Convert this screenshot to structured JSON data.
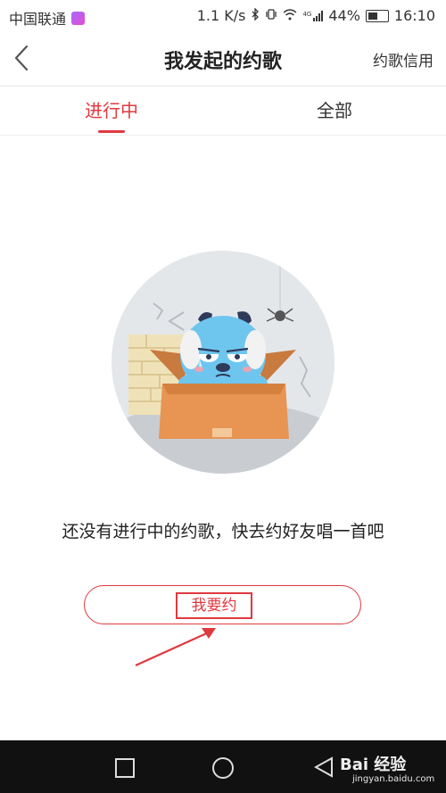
{
  "status_bar": {
    "carrier": "中国联通",
    "network_speed": "1.1 K/s",
    "network_type": "4G",
    "battery": "44%",
    "time": "16:10"
  },
  "nav": {
    "title": "我发起的约歌",
    "right_action": "约歌信用",
    "back_icon": "chevron-left-icon"
  },
  "tabs": [
    {
      "label": "进行中",
      "active": true
    },
    {
      "label": "全部",
      "active": false
    }
  ],
  "empty_state": {
    "message": "还没有进行中的约歌，快去约好友唱一首吧",
    "illustration": "sad-dog-in-box"
  },
  "cta": {
    "label": "我要约"
  },
  "watermark": {
    "main": "Bai 经验",
    "sub": "jingyan.baidu.com"
  },
  "colors": {
    "accent": "#e0393e",
    "sysnav": "#111111"
  }
}
